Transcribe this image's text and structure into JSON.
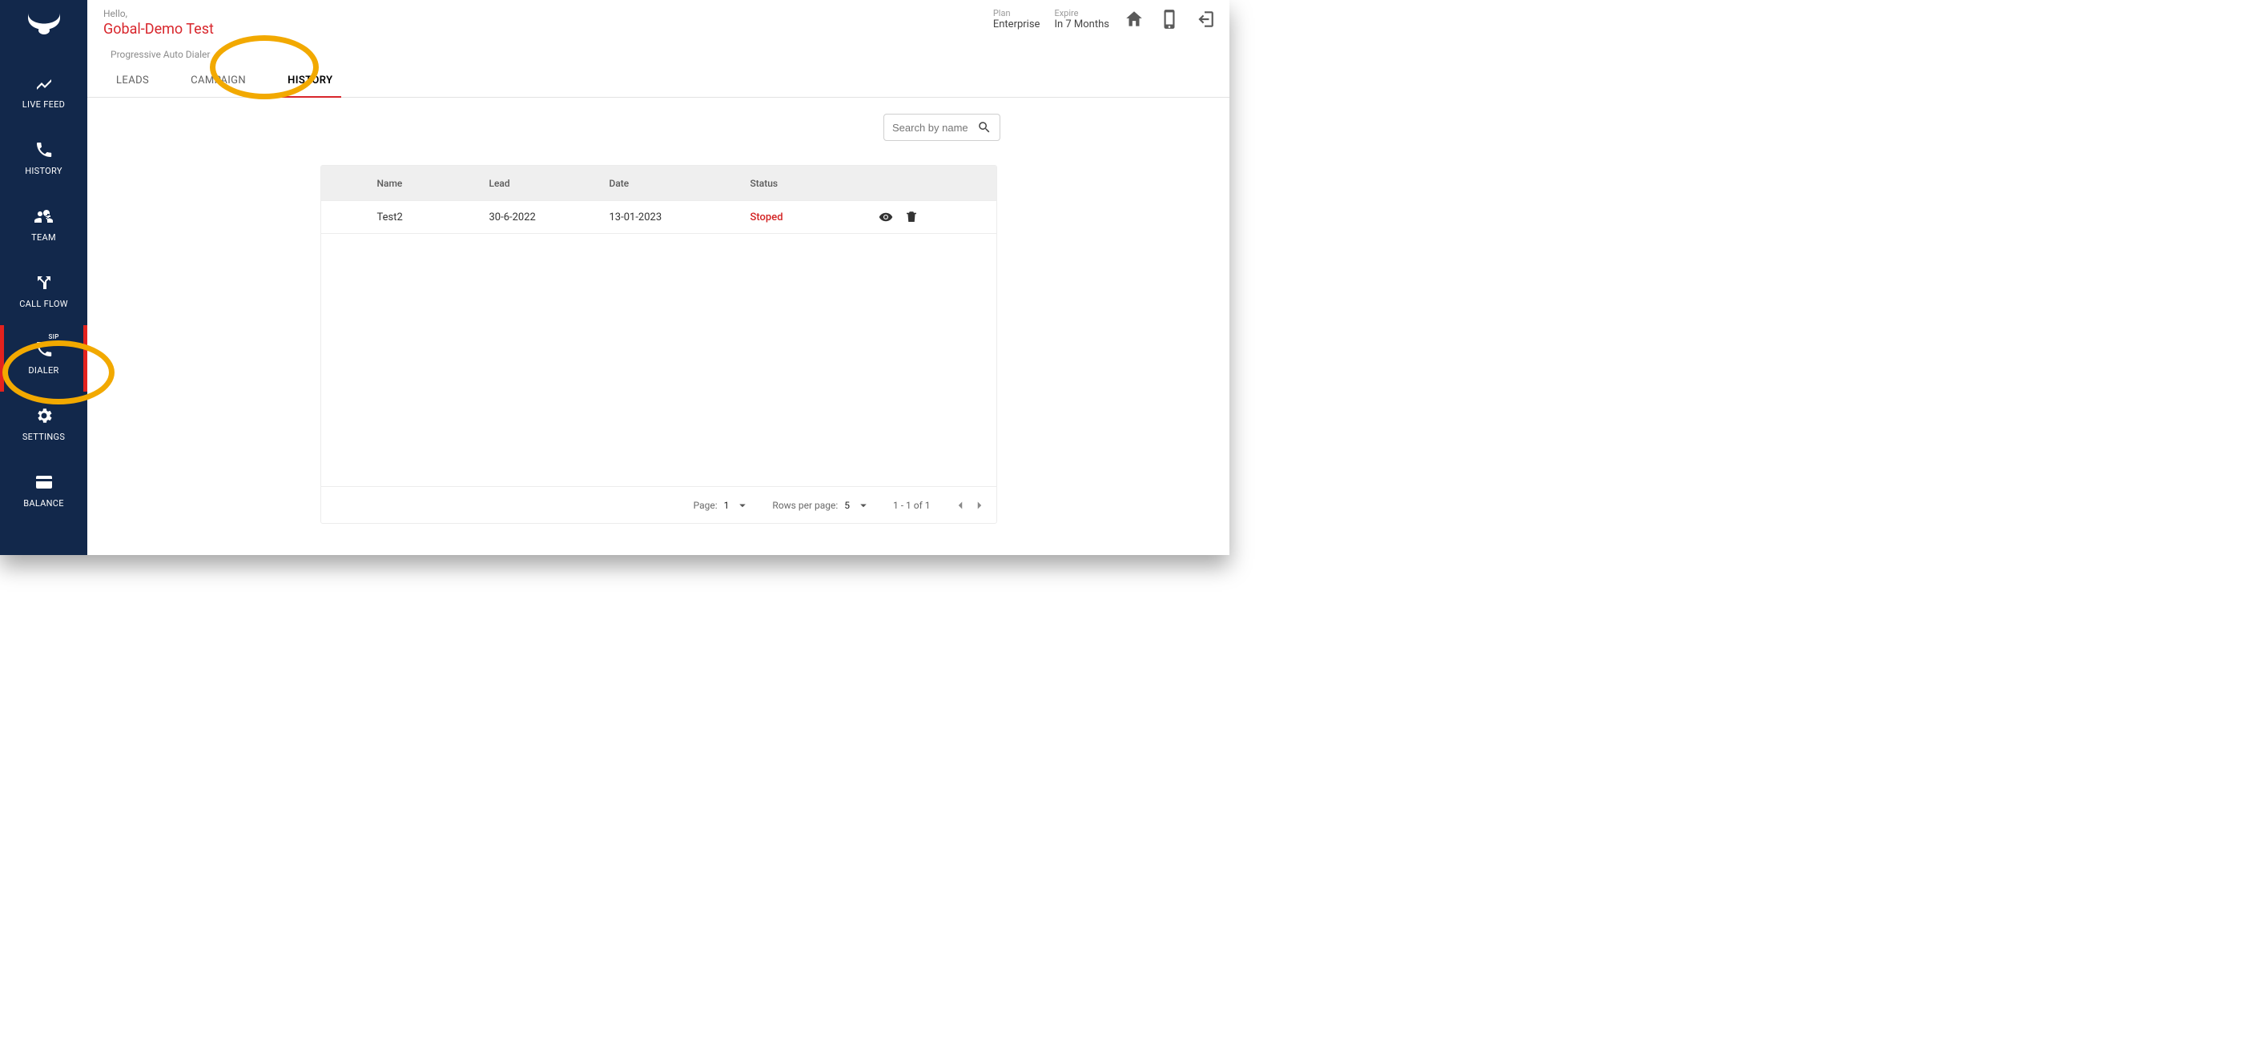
{
  "header": {
    "hello": "Hello,",
    "username": "Gobal-Demo Test",
    "plan_label": "Plan",
    "plan_value": "Enterprise",
    "expire_label": "Expire",
    "expire_value": "In 7 Months"
  },
  "section_title": "Progressive Auto Dialer",
  "tabs": {
    "leads": "LEADS",
    "campaign": "CAMPAIGN",
    "history": "HISTORY"
  },
  "sidebar": {
    "live_feed": "LIVE FEED",
    "history": "HISTORY",
    "team": "TEAM",
    "call_flow": "CALL FLOW",
    "dialer": "DIALER",
    "dialer_sip": "SIP",
    "settings": "SETTINGS",
    "balance": "BALANCE"
  },
  "search": {
    "placeholder": "Search by name"
  },
  "table": {
    "columns": {
      "name": "Name",
      "lead": "Lead",
      "date": "Date",
      "status": "Status"
    },
    "rows": [
      {
        "name": "Test2",
        "lead": "30-6-2022",
        "date": "13-01-2023",
        "status": "Stoped"
      }
    ]
  },
  "pagination": {
    "page_label": "Page:",
    "page_value": "1",
    "rows_label": "Rows per page:",
    "rows_value": "5",
    "range": "1 - 1 of 1"
  }
}
